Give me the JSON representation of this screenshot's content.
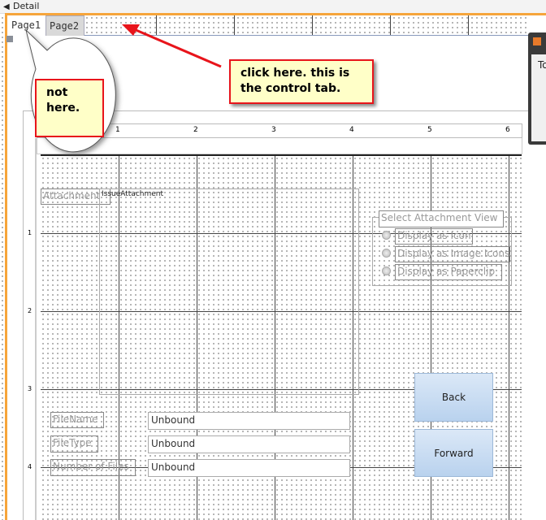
{
  "section": {
    "title": "Detail"
  },
  "tabs": [
    {
      "label": "Page1"
    },
    {
      "label": "Page2"
    }
  ],
  "ruler": {
    "h": [
      "1",
      "2",
      "3",
      "4",
      "5",
      "6"
    ],
    "v": [
      "1",
      "2",
      "3",
      "4"
    ]
  },
  "attachment": {
    "label": "Attachment",
    "control": "IssueAttachment"
  },
  "option_group": {
    "label": "Select Attachment View",
    "options": [
      "Display as Icon",
      "Display as Image Icons",
      "Display as Paperclip"
    ]
  },
  "fields": [
    {
      "label": "FileName",
      "value": "Unbound"
    },
    {
      "label": "FileType",
      "value": "Unbound"
    },
    {
      "label": "Number of Files",
      "value": "Unbound"
    }
  ],
  "buttons": {
    "back": "Back",
    "forward": "Forward"
  },
  "annotations": {
    "callout": "not here.",
    "note": "click here. this is the control tab."
  },
  "side_window": {
    "title": "To"
  },
  "colors": {
    "accent": "#f6a53b",
    "annotation_border": "#e8141b",
    "note_bg": "#ffffc8"
  }
}
